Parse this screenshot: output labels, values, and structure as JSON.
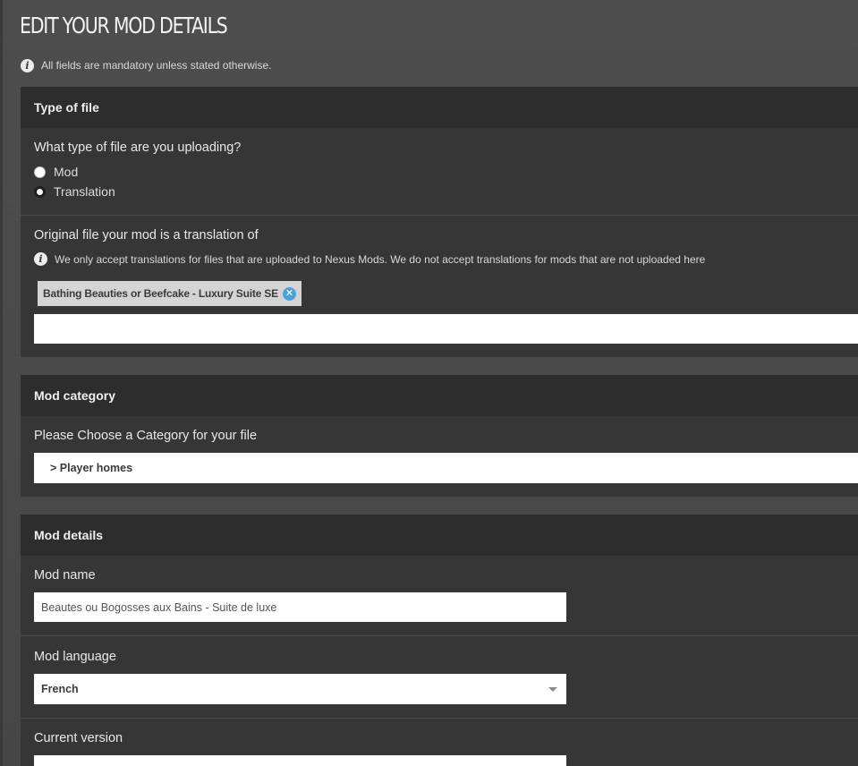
{
  "page": {
    "title": "EDIT YOUR MOD DETAILS",
    "notice": "All fields are mandatory unless stated otherwise."
  },
  "colors": {
    "background": "#4a4a4a",
    "section_bg": "#363636",
    "section_header_bg": "#2d2d2d",
    "accent": "#4aa3d9"
  },
  "icons": {
    "info": "info-icon",
    "remove_tag": "close-circle-icon",
    "dropdown": "chevron-down-icon"
  },
  "type_of_file": {
    "header": "Type of file",
    "question": "What type of file are you uploading?",
    "options": [
      {
        "label": "Mod",
        "checked": false
      },
      {
        "label": "Translation",
        "checked": true
      }
    ],
    "original_file_label": "Original file your mod is a translation of",
    "original_file_info": "We only accept translations for files that are uploaded to Nexus Mods. We do not accept translations for mods that are not uploaded here",
    "selected_tag": "Bathing Beauties or Beefcake - Luxury Suite SE",
    "search_value": ""
  },
  "mod_category": {
    "header": "Mod category",
    "label": "Please Choose a Category for your file",
    "selected": "> Player homes"
  },
  "mod_details": {
    "header": "Mod details",
    "name_label": "Mod name",
    "name_value": "Beautes ou Bogosses aux Bains - Suite de luxe",
    "language_label": "Mod language",
    "language_value": "French",
    "version_label": "Current version",
    "version_value": ""
  }
}
